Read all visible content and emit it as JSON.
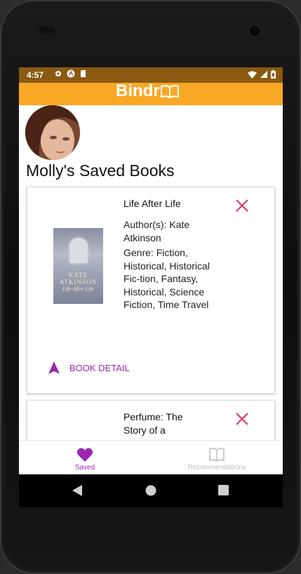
{
  "status": {
    "time": "4:57"
  },
  "app": {
    "brand": "Bindr",
    "accent": "#f9a825",
    "purple": "#9c27b0"
  },
  "profile": {
    "title": "Molly's Saved Books"
  },
  "books": [
    {
      "title": "Life After Life",
      "authors": "Author(s): Kate Atkinson",
      "genre": "Genre: Fiction, Historical, Historical Fic-tion, Fantasy, Historical, Science Fiction, Time Travel",
      "cover_author": "KATE ATKINSON",
      "cover_title": "Life After Life",
      "detail_label": "BOOK DETAIL"
    },
    {
      "title": "Perfume: The Story of a Murderer"
    }
  ],
  "nav": {
    "saved": "Saved",
    "recommendations": "Recommendations"
  },
  "icons": {
    "remove": "close-icon",
    "detail": "navigation-arrow-icon",
    "saved": "heart-icon",
    "recommendations": "book-icon"
  }
}
